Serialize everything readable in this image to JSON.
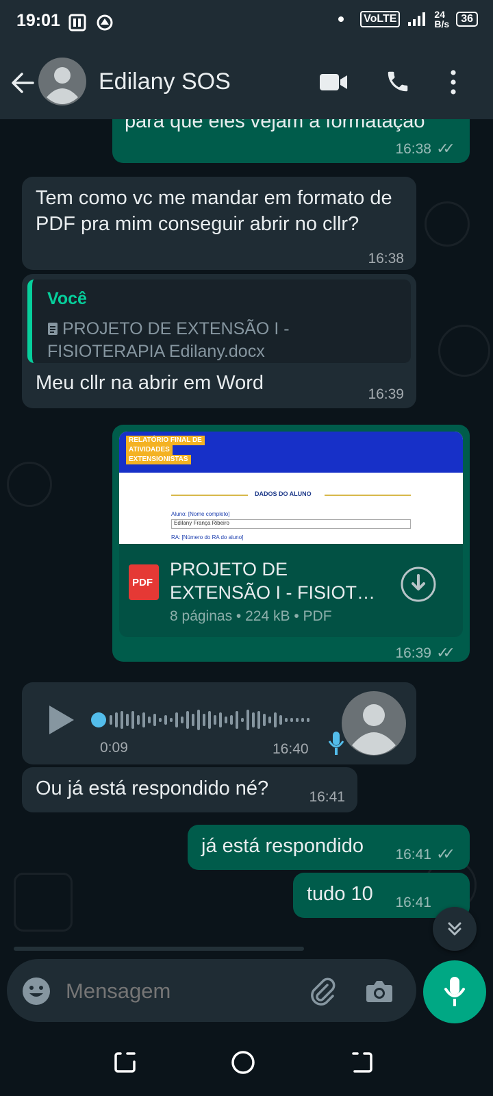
{
  "status_bar": {
    "time": "19:01",
    "network": "VoLTE",
    "speed_value": "24",
    "speed_unit": "B/s",
    "battery": "36"
  },
  "header": {
    "contact_name": "Edilany SOS",
    "back_icon": "arrow-left-icon",
    "video_icon": "video-camera-icon",
    "call_icon": "phone-icon",
    "menu_icon": "more-vert-icon"
  },
  "messages": [
    {
      "direction": "out",
      "text": "para que eles vejam a formatação",
      "time": "16:38",
      "status": "read"
    },
    {
      "direction": "in",
      "text": "Tem como vc me mandar em formato de PDF pra mim conseguir abrir no cllr?",
      "time": "16:38"
    },
    {
      "direction": "in",
      "quote_author": "Você",
      "quote_text": "PROJETO DE EXTENSÃO I - FISIOTERAPIA Edilany.docx",
      "text": "Meu cllr na abrir em Word",
      "time": "16:39"
    },
    {
      "direction": "out",
      "type": "document",
      "preview_banner": [
        "RELATÓRIO FINAL DE",
        "ATIVIDADES",
        "EXTENSIONISTAS"
      ],
      "preview_section": "DADOS DO ALUNO",
      "preview_field1_label": "Aluno: [Nome completo]",
      "preview_field1_value": "Edilany França Ribeiro",
      "preview_field2_label": "RA: [Número do RA do aluno]",
      "file_icon_label": "PDF",
      "file_name": "PROJETO DE EXTENSÃO I - FISIOT…",
      "pages": "8 páginas",
      "size": "224 kB",
      "type_label": "PDF",
      "time": "16:39",
      "status": "read"
    },
    {
      "direction": "in",
      "type": "voice",
      "duration": "0:09",
      "time": "16:40"
    },
    {
      "direction": "in",
      "text": "Ou já está respondido né?",
      "time": "16:41"
    },
    {
      "direction": "out",
      "text": "já está respondido",
      "time": "16:41",
      "status": "read"
    },
    {
      "direction": "out",
      "text": "tudo 10",
      "time": "16:41",
      "status": "read"
    }
  ],
  "composer": {
    "placeholder": "Mensagem",
    "emoji_icon": "emoji-icon",
    "attach_icon": "paperclip-icon",
    "camera_icon": "camera-icon",
    "mic_icon": "mic-icon"
  },
  "colors": {
    "background": "#0b141a",
    "header": "#1f2c34",
    "incoming_bubble": "#1f2c34",
    "outgoing_bubble": "#005c4b",
    "accent": "#00a884",
    "quote_author": "#06cf9c",
    "voice_dot": "#53bdeb"
  }
}
